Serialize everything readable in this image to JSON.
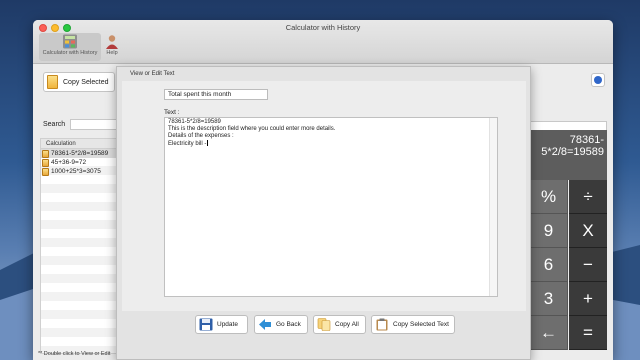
{
  "window": {
    "title": "Calculator with History"
  },
  "toolbar": {
    "items": [
      {
        "label": "Calculator with History",
        "icon": "calculator-icon"
      },
      {
        "label": "Help",
        "icon": "person-icon"
      }
    ]
  },
  "left_panel": {
    "copy_selected_label": "Copy Selected",
    "search_label": "Search",
    "column_header": "Calculation",
    "rows": [
      "78361-5*2/8=19589",
      "45+36-9=72",
      "1000+25*3=3075"
    ],
    "footnote": "** Double click to View or Edit"
  },
  "calculator": {
    "display": "78361-5*2/8=19589",
    "keys": [
      "%",
      "÷",
      "9",
      "X",
      "6",
      "−",
      "3",
      "+",
      "←",
      "="
    ]
  },
  "dialog": {
    "title": "View or Edit Text",
    "title_value": "Total spent this month",
    "text_label": "Text :",
    "text_lines": [
      "78361-5*2/8=19589",
      "",
      "This is the description field where you could enter more details.",
      "",
      "Details of the expenses :",
      "",
      "Electricity bill -"
    ],
    "buttons": {
      "update": "Update",
      "go_back": "Go Back",
      "copy_all": "Copy All",
      "copy_selected_text": "Copy Selected Text"
    }
  },
  "colors": {
    "accent": "#2f66c9",
    "display_bg": "#5d5d5d",
    "operator_bg": "#3a3a3a"
  }
}
